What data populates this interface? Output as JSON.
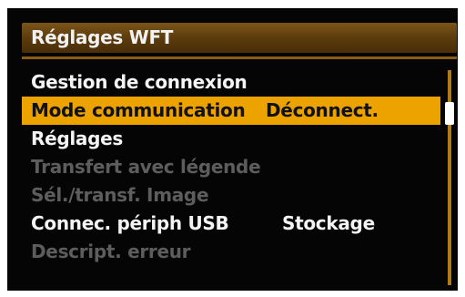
{
  "title": "Réglages WFT",
  "menu": {
    "items": [
      {
        "label": "Gestion de connexion",
        "value": "",
        "state": "enabled"
      },
      {
        "label": "Mode communication",
        "value": "Déconnect.",
        "state": "selected"
      },
      {
        "label": "Réglages",
        "value": "",
        "state": "enabled"
      },
      {
        "label": "Transfert avec légende",
        "value": "",
        "state": "disabled"
      },
      {
        "label": "Sél./transf. Image",
        "value": "",
        "state": "disabled"
      },
      {
        "label": "Connec. périph USB",
        "value": "Stockage",
        "state": "enabled"
      },
      {
        "label": "Descript. erreur",
        "value": "",
        "state": "disabled"
      }
    ]
  },
  "colors": {
    "background": "#050505",
    "title_bar": "#5a3a0d",
    "highlight": "#eca300",
    "scrollbar": "#b07a15",
    "text_enabled": "#f4f4f4",
    "text_disabled": "#5d5d5d"
  },
  "scrollbar": {
    "position_fraction": 0.15
  }
}
